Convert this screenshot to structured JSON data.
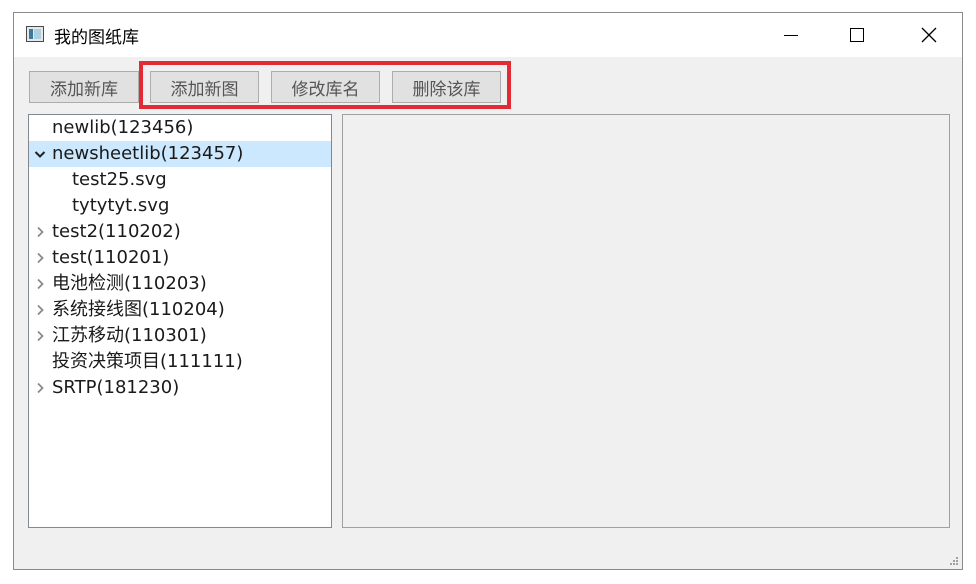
{
  "window": {
    "title": "我的图纸库"
  },
  "toolbar": {
    "add_lib": "添加新库",
    "add_drawing": "添加新图",
    "rename_lib": "修改库名",
    "delete_lib": "删除该库"
  },
  "tree": {
    "items": [
      {
        "label": "newlib(123456)",
        "level": 0,
        "expander": "none",
        "selected": false
      },
      {
        "label": "newsheetlib(123457)",
        "level": 0,
        "expander": "expanded",
        "selected": true
      },
      {
        "label": "test25.svg",
        "level": 1,
        "expander": "none",
        "selected": false
      },
      {
        "label": "tytytyt.svg",
        "level": 1,
        "expander": "none",
        "selected": false
      },
      {
        "label": "test2(110202)",
        "level": 0,
        "expander": "collapsed",
        "selected": false
      },
      {
        "label": "test(110201)",
        "level": 0,
        "expander": "collapsed",
        "selected": false
      },
      {
        "label": "电池检测(110203)",
        "level": 0,
        "expander": "collapsed",
        "selected": false
      },
      {
        "label": "系统接线图(110204)",
        "level": 0,
        "expander": "collapsed",
        "selected": false
      },
      {
        "label": "江苏移动(110301)",
        "level": 0,
        "expander": "collapsed",
        "selected": false
      },
      {
        "label": "投资决策项目(111111)",
        "level": 0,
        "expander": "none",
        "selected": false
      },
      {
        "label": "SRTP(181230)",
        "level": 0,
        "expander": "collapsed",
        "selected": false
      }
    ]
  },
  "colors": {
    "selection": "#cce8ff",
    "highlight_box": "#e32b35",
    "window_bg": "#f0f0f0"
  }
}
